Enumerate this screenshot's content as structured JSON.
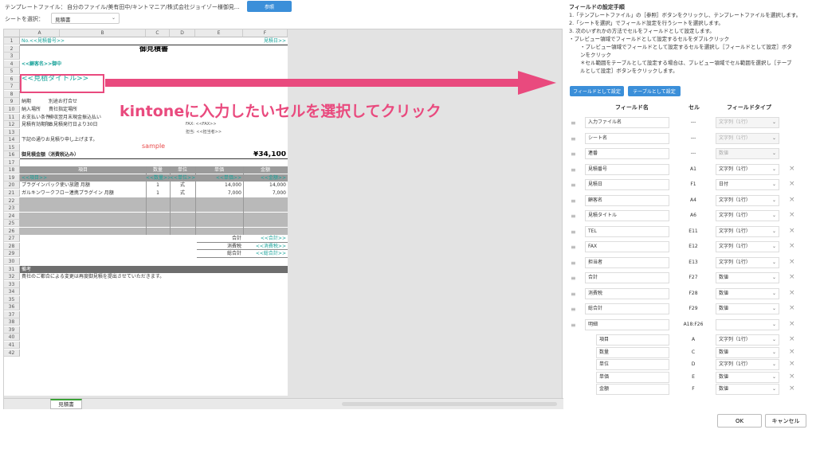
{
  "toolbar": {
    "template_label": "テンプレートファイル：",
    "template_path": "自分のファイル/美有田中/キントマニア/株式会社ジョイゾー様御見...",
    "browse_button": "参照",
    "sheet_label": "シートを選択：",
    "sheet_value": "見積書"
  },
  "sheet": {
    "columns": [
      "A",
      "B",
      "C",
      "D",
      "E",
      "F"
    ],
    "rows": [
      "1",
      "2",
      "3",
      "4",
      "5",
      "6",
      "7",
      "8",
      "9",
      "10",
      "11",
      "12",
      "13",
      "14",
      "15",
      "16",
      "17",
      "18",
      "19",
      "20",
      "21",
      "22",
      "23",
      "24",
      "25",
      "26",
      "27",
      "28",
      "29",
      "30",
      "31",
      "32",
      "33",
      "34",
      "35",
      "36",
      "37",
      "38",
      "39",
      "40",
      "41",
      "42"
    ],
    "cells": {
      "estimate_no": "No.<<見積番号>>",
      "estimate_date": "見積日>>",
      "title": "御見積書",
      "customer": "<<顧客名>>御中",
      "estimate_title": "<<見積タイトル>>",
      "deadline_label": "納期",
      "deadline_value": "別途お打合せ",
      "place_label": "納入場所",
      "place_value": "貴社指定場所",
      "payment_label": "お支払い条件",
      "payment_value": "検収翌月末現金振込払い",
      "validity_label": "見積有効期限",
      "validity_value": "本見積発行日より30日",
      "fax": "FAX: <<FAX>>",
      "person": "担当: <<担当者>>",
      "intro": "下記の通りお見積り申し上げます。",
      "total_label": "御見積金額（消費税込み）",
      "total_value": "¥34,100",
      "hdr_item": "項目",
      "hdr_qty": "数量",
      "hdr_unit": "単位",
      "hdr_price": "単価",
      "hdr_amount": "金額",
      "ph_item": "<<項目>>",
      "ph_qty": "<<数量>>",
      "ph_unit": "<<単位>>",
      "ph_price": "<<単価>>",
      "ph_amount": "<<金額>>",
      "line1_item": "プラグインパック使い放題 月額",
      "line1_qty": "1",
      "line1_unit": "式",
      "line1_price": "14,000",
      "line1_amount": "14,000",
      "line2_item": "ガルキンワークフロー連携プラグイン 月額",
      "line2_qty": "1",
      "line2_unit": "式",
      "line2_price": "7,000",
      "line2_amount": "7,000",
      "subtotal_label": "合計",
      "subtotal_value": "<<合計>>",
      "tax_label": "消費税",
      "tax_value": "<<消費税>>",
      "grand_label": "総合計",
      "grand_value": "<<総合計>>",
      "notes_label": "備考",
      "notes_text": "貴社のご都合による変更は再度御見積を提出させていただきます。"
    },
    "tab": "見積書"
  },
  "overlay": {
    "callout": "kintoneに入力したいセルを選択してクリック",
    "sample": "sample"
  },
  "panel": {
    "title": "フィールドの設定手順",
    "steps": [
      "1.「テンプレートファイル」の［参照］ボタンをクリックし、テンプレートファイルを選択します。",
      "2.「シートを選択」でフィールド設定を行うシートを選択します。",
      "3. 次のいずれかの方法でセルをフィールドとして設定します。",
      "・プレビュー領域でフィールドとして設定するセルをダブルクリック",
      "・プレビュー領域でフィールドとして設定するセルを選択し［フィールドとして設定］ボタ",
      "ンをクリック",
      "＊セル範囲をテーブルとして設定する場合は、プレビュー領域でセル範囲を選択し［テーブ",
      "ルとして設定］ボタンをクリックします。"
    ],
    "btn_field": "フィールドとして設定",
    "btn_table": "テーブルとして設定",
    "col_name": "フィールド名",
    "col_cell": "セル",
    "col_type": "フィールドタイプ",
    "fields": [
      {
        "name": "入力ファイル名",
        "cell": "---",
        "type": "文字列（1行）"
      },
      {
        "name": "シート名",
        "cell": "---",
        "type": "文字列（1行）"
      },
      {
        "name": "連番",
        "cell": "---",
        "type": "数値"
      },
      {
        "name": "見積番号",
        "cell": "A1",
        "type": "文字列（1行）"
      },
      {
        "name": "見積日",
        "cell": "F1",
        "type": "日付"
      },
      {
        "name": "顧客名",
        "cell": "A4",
        "type": "文字列（1行）"
      },
      {
        "name": "見積タイトル",
        "cell": "A6",
        "type": "文字列（1行）"
      },
      {
        "name": "TEL",
        "cell": "E11",
        "type": "文字列（1行）"
      },
      {
        "name": "FAX",
        "cell": "E12",
        "type": "文字列（1行）"
      },
      {
        "name": "担当者",
        "cell": "E13",
        "type": "文字列（1行）"
      },
      {
        "name": "合計",
        "cell": "F27",
        "type": "数値"
      },
      {
        "name": "消費税",
        "cell": "F28",
        "type": "数値"
      },
      {
        "name": "総合計",
        "cell": "F29",
        "type": "数値"
      },
      {
        "name": "明細",
        "cell": "A18:F26",
        "type": ""
      }
    ],
    "sub_fields": [
      {
        "name": "項目",
        "cell": "A",
        "type": "文字列（1行）"
      },
      {
        "name": "数量",
        "cell": "C",
        "type": "数値"
      },
      {
        "name": "単位",
        "cell": "D",
        "type": "文字列（1行）"
      },
      {
        "name": "単価",
        "cell": "E",
        "type": "数値"
      },
      {
        "name": "金額",
        "cell": "F",
        "type": "数値"
      }
    ],
    "ok": "OK",
    "cancel": "キャンセル"
  }
}
